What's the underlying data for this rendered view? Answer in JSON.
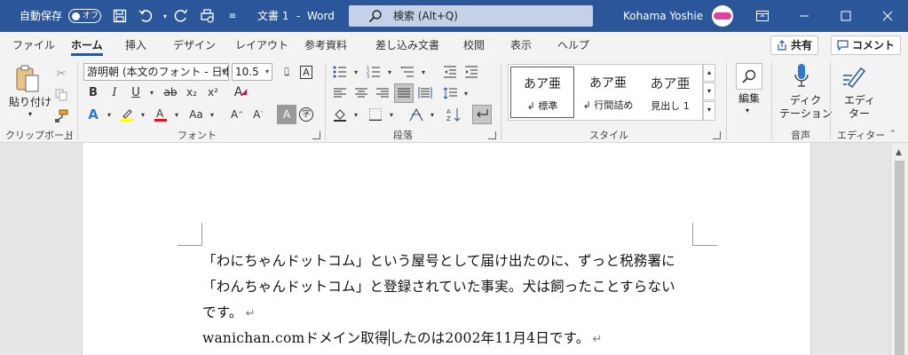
{
  "titlebar": {
    "autosave_label": "自動保存",
    "autosave_state": "オフ",
    "doc_title": "文書 1",
    "app_name": "Word",
    "separator": "-",
    "search_placeholder": "検索 (Alt+Q)",
    "user_name": "Kohama Yoshie",
    "accent": "#2b579a"
  },
  "tabs": {
    "items": [
      "ファイル",
      "ホーム",
      "挿入",
      "デザイン",
      "レイアウト",
      "参考資料",
      "差し込み文書",
      "校閲",
      "表示",
      "ヘルプ"
    ],
    "active": "ホーム",
    "share_label": "共有",
    "comment_label": "コメント"
  },
  "ribbon": {
    "clipboard": {
      "paste_label": "貼り付け",
      "group_label": "クリップボード"
    },
    "font": {
      "font_name": "游明朝 (本文のフォント - 日本",
      "font_size": "10.5",
      "group_label": "フォント",
      "bold": "B",
      "italic": "I",
      "underline": "U",
      "strike": "ab",
      "subscript": "x₂",
      "superscript": "x²",
      "font_color": "#e81123",
      "highlight_color": "#ffff00"
    },
    "paragraph": {
      "group_label": "段落"
    },
    "styles": {
      "group_label": "スタイル",
      "items": [
        {
          "sample": "あア亜",
          "name": "標準"
        },
        {
          "sample": "あア亜",
          "name": "行間詰め"
        },
        {
          "sample": "あア亜",
          "name": "見出し 1"
        }
      ]
    },
    "editing": {
      "label": "編集"
    },
    "voice": {
      "label_line1": "ディク",
      "label_line2": "テーション",
      "group_label": "音声"
    },
    "editor": {
      "label_line1": "エディ",
      "label_line2": "ター",
      "group_label": "エディター"
    }
  },
  "document": {
    "lines": [
      "「わにちゃんドットコム」という屋号として届け出たのに、ずっと税務署に",
      "「わんちゃんドットコム」と登録されていた事実。犬は飼ったことすらない",
      "です。"
    ],
    "line4_before_caret": "wanichan.comドメイン取得",
    "line4_after_caret": "したのは2002年11月4日です。",
    "paragraph_mark": "↵"
  }
}
